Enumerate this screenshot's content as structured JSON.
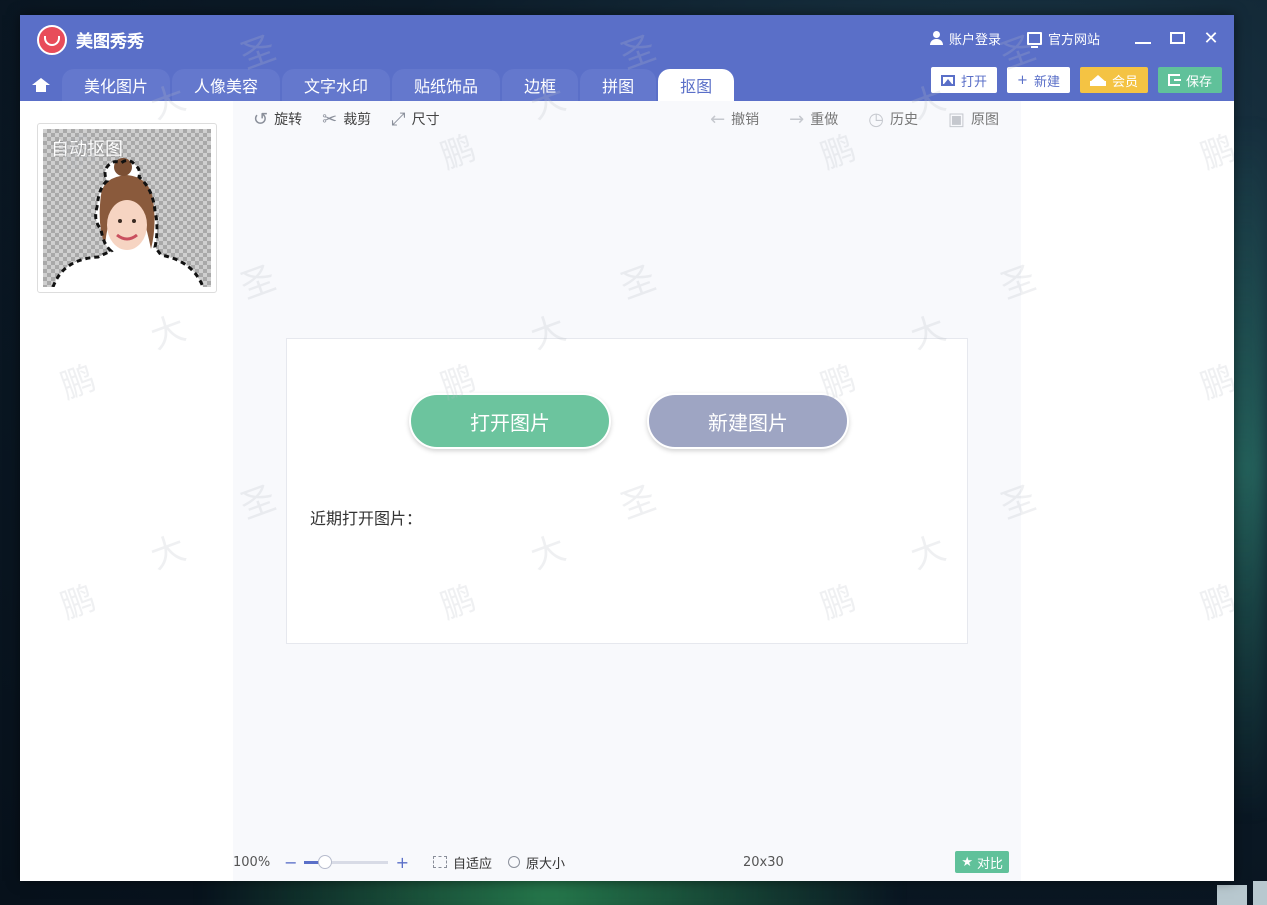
{
  "app": {
    "title": "美图秀秀",
    "account_login": "账户登录",
    "official_site": "官方网站"
  },
  "tabs": [
    {
      "label": "美化图片"
    },
    {
      "label": "人像美容"
    },
    {
      "label": "文字水印"
    },
    {
      "label": "贴纸饰品"
    },
    {
      "label": "边框"
    },
    {
      "label": "拼图"
    },
    {
      "label": "抠图"
    }
  ],
  "actions": {
    "open": "打开",
    "new": "新建",
    "vip": "会员",
    "save": "保存"
  },
  "sidebar": {
    "auto_cutout_label": "自动抠图"
  },
  "toolbar": {
    "rotate": "旋转",
    "crop": "裁剪",
    "size": "尺寸",
    "undo": "撤销",
    "redo": "重做",
    "history": "历史",
    "original": "原图"
  },
  "start": {
    "open_image": "打开图片",
    "new_image": "新建图片",
    "recent_label": "近期打开图片："
  },
  "status": {
    "zoom": "100%",
    "zoom_level": 0.25,
    "fit": "自适应",
    "original_size": "原大小",
    "dimensions": "20x30",
    "compare": "对比"
  },
  "watermark": [
    "圣",
    "大",
    "鹏"
  ],
  "colors": {
    "accent": "#5a6fc8",
    "green": "#60c19a",
    "gold": "#f4c343"
  }
}
